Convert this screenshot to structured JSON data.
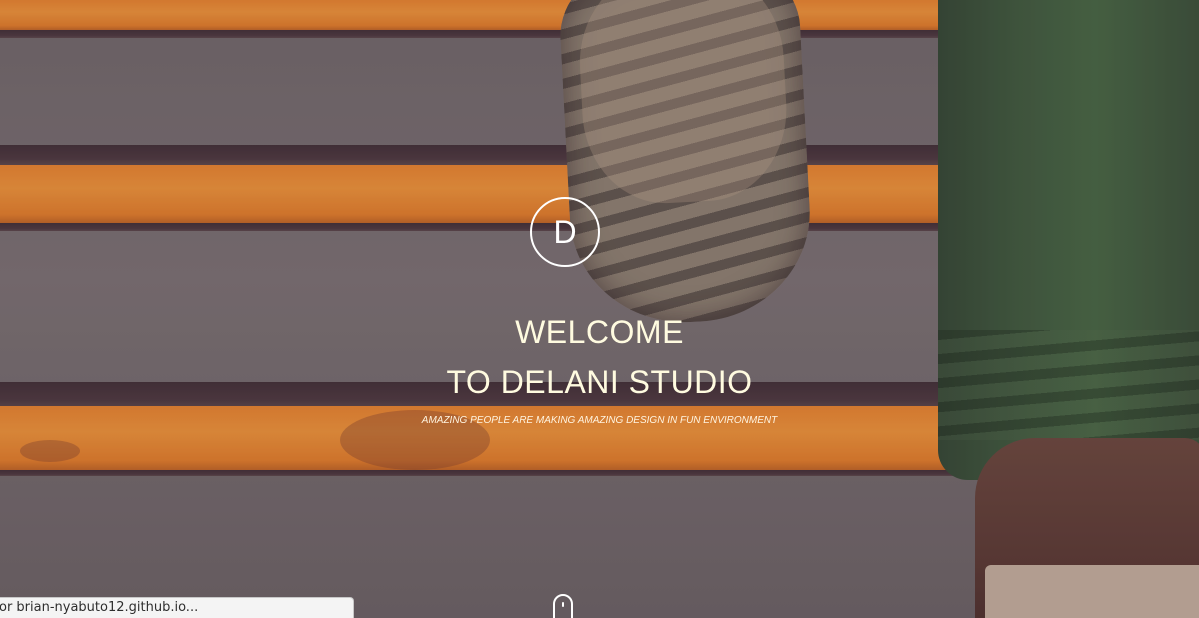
{
  "hero": {
    "logo_letter": "D",
    "title_line1": "WELCOME",
    "title_line2": "TO DELANI STUDIO",
    "tagline": "AMAZING PEOPLE ARE MAKING AMAZING DESIGN IN FUN ENVIRONMENT",
    "scroll_icon": "mouse-scroll-icon"
  },
  "browser_status": {
    "text": "or brian-nyabuto12.github.io..."
  },
  "colors": {
    "stripe_orange": "#f08a2a",
    "concrete_gray": "#757170",
    "pants_green": "#3b5d3a",
    "text_cream": "#fffbe0"
  }
}
